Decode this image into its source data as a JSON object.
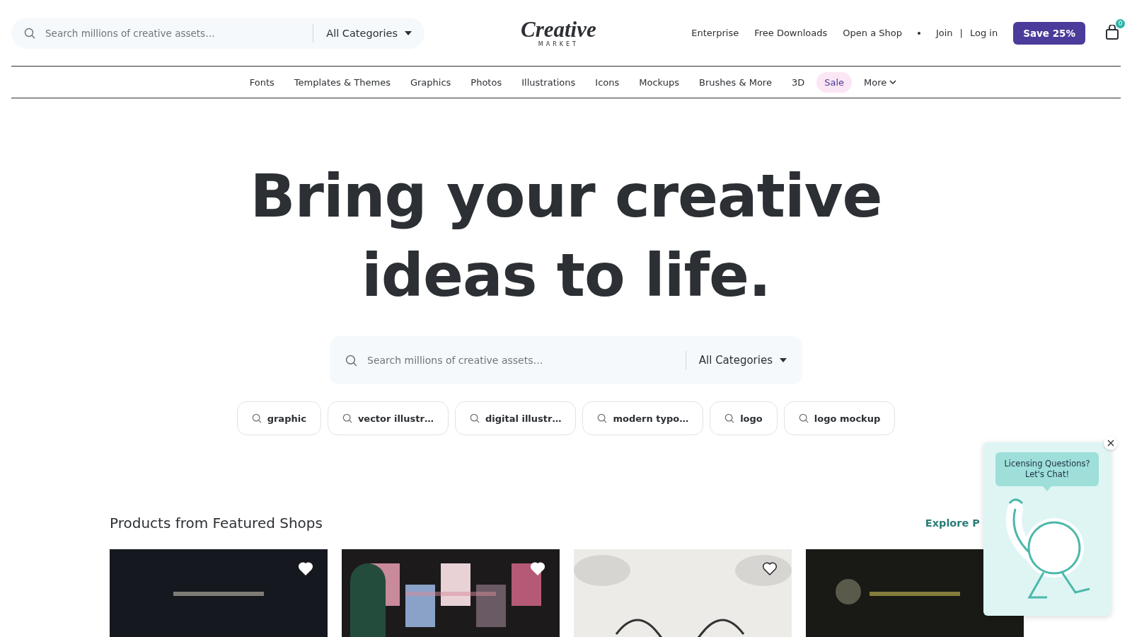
{
  "header": {
    "search": {
      "placeholder": "Search millions of creative assets…",
      "category": "All Categories"
    },
    "logo": {
      "word": "Creative",
      "sub": "MARKET"
    },
    "links": [
      "Enterprise",
      "Free Downloads",
      "Open a Shop"
    ],
    "join": "Join",
    "separator": "|",
    "login": "Log in",
    "promo_button": "Save 25%",
    "cart_count": "0"
  },
  "nav": [
    {
      "label": "Fonts",
      "kind": "plain"
    },
    {
      "label": "Templates & Themes",
      "kind": "plain"
    },
    {
      "label": "Graphics",
      "kind": "plain"
    },
    {
      "label": "Photos",
      "kind": "plain"
    },
    {
      "label": "Illustrations",
      "kind": "plain"
    },
    {
      "label": "Icons",
      "kind": "plain"
    },
    {
      "label": "Mockups",
      "kind": "plain"
    },
    {
      "label": "Brushes & More",
      "kind": "plain"
    },
    {
      "label": "3D",
      "kind": "plain"
    },
    {
      "label": "Sale",
      "kind": "sale"
    },
    {
      "label": "More",
      "kind": "dropdown"
    }
  ],
  "hero": {
    "title_lines": [
      "Bring your creative",
      "ideas to life."
    ],
    "search": {
      "placeholder": "Search millions of creative assets…",
      "category": "All Categories"
    },
    "suggestions": [
      "graphic",
      "vector illustr…",
      "digital illustr…",
      "modern typo…",
      "logo",
      "logo mockup"
    ]
  },
  "featured": {
    "title": "Products from Featured Shops",
    "link": "Explore P",
    "products": [
      {
        "kind": "picture",
        "heart": true
      },
      {
        "kind": "picture",
        "heart": true
      },
      {
        "kind": "picture",
        "heart": true
      },
      {
        "kind": "picture",
        "heart": false
      }
    ]
  },
  "chat_widget": {
    "bubble_lines": [
      "Licensing Questions?",
      "Let's Chat!"
    ]
  }
}
